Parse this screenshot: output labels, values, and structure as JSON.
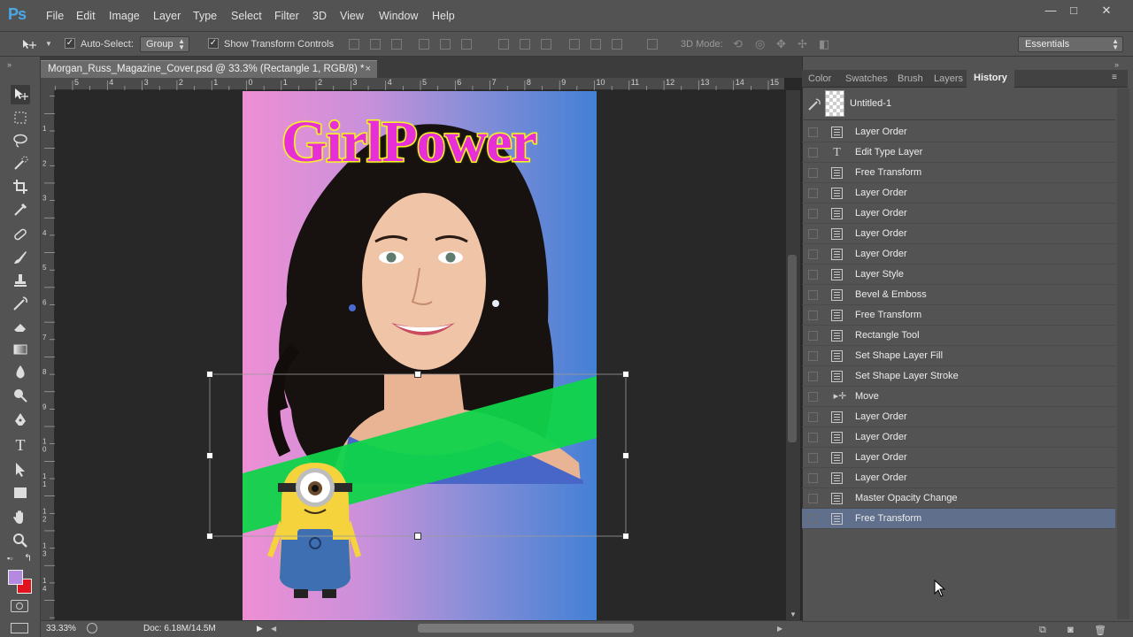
{
  "app": {
    "logo": "Ps"
  },
  "menu": [
    "File",
    "Edit",
    "Image",
    "Layer",
    "Type",
    "Select",
    "Filter",
    "3D",
    "View",
    "Window",
    "Help"
  ],
  "window_controls": {
    "minimize": "—",
    "maximize": "□",
    "close": "✕"
  },
  "options_bar": {
    "auto_select_label": "Auto-Select:",
    "auto_select_value": "Group",
    "show_transform_label": "Show Transform Controls",
    "mode_3d_label": "3D Mode:",
    "workspace": "Essentials"
  },
  "document": {
    "tab_title": "Morgan_Russ_Magazine_Cover.psd @ 33.3% (Rectangle 1, RGB/8) *",
    "close_glyph": "×",
    "headline": "GirlPower",
    "zoom": "33.33%",
    "doc_size": "Doc: 6.18M/14.5M"
  },
  "ruler": {
    "top": [
      "5",
      "4",
      "3",
      "2",
      "1",
      "0",
      "1",
      "2",
      "3",
      "4",
      "5",
      "6",
      "7",
      "8",
      "9",
      "10",
      "11",
      "12",
      "13",
      "14",
      "15"
    ],
    "left": [
      "1",
      "2",
      "3",
      "4",
      "5",
      "6",
      "7",
      "8",
      "9",
      "1\n0",
      "1\n1",
      "1\n2",
      "1\n3",
      "1\n4"
    ]
  },
  "panel": {
    "tabs": [
      "Color",
      "Swatches",
      "Brush",
      "Layers",
      "History"
    ],
    "active_tab": "History",
    "snapshot_label": "Untitled-1",
    "history": [
      {
        "label": "Layer Order",
        "icon": "doc-icon"
      },
      {
        "label": "Edit Type Layer",
        "icon": "type-icon"
      },
      {
        "label": "Free Transform",
        "icon": "doc-icon"
      },
      {
        "label": "Layer Order",
        "icon": "doc-icon"
      },
      {
        "label": "Layer Order",
        "icon": "doc-icon"
      },
      {
        "label": "Layer Order",
        "icon": "doc-icon"
      },
      {
        "label": "Layer Order",
        "icon": "doc-icon"
      },
      {
        "label": "Layer Style",
        "icon": "doc-icon"
      },
      {
        "label": "Bevel & Emboss",
        "icon": "doc-icon"
      },
      {
        "label": "Free Transform",
        "icon": "doc-icon"
      },
      {
        "label": "Rectangle Tool",
        "icon": "doc-icon"
      },
      {
        "label": "Set Shape Layer Fill",
        "icon": "doc-icon"
      },
      {
        "label": "Set Shape Layer Stroke",
        "icon": "doc-icon"
      },
      {
        "label": "Move",
        "icon": "move-icon"
      },
      {
        "label": "Layer Order",
        "icon": "doc-icon"
      },
      {
        "label": "Layer Order",
        "icon": "doc-icon"
      },
      {
        "label": "Layer Order",
        "icon": "doc-icon"
      },
      {
        "label": "Layer Order",
        "icon": "doc-icon"
      },
      {
        "label": "Master Opacity Change",
        "icon": "doc-icon"
      },
      {
        "label": "Free Transform",
        "icon": "doc-icon"
      }
    ],
    "selected_index": 19
  },
  "colors": {
    "foreground": "#b38ae0",
    "background": "#e0141c",
    "selection": "#5f6f8c",
    "band": "#10d44a"
  }
}
